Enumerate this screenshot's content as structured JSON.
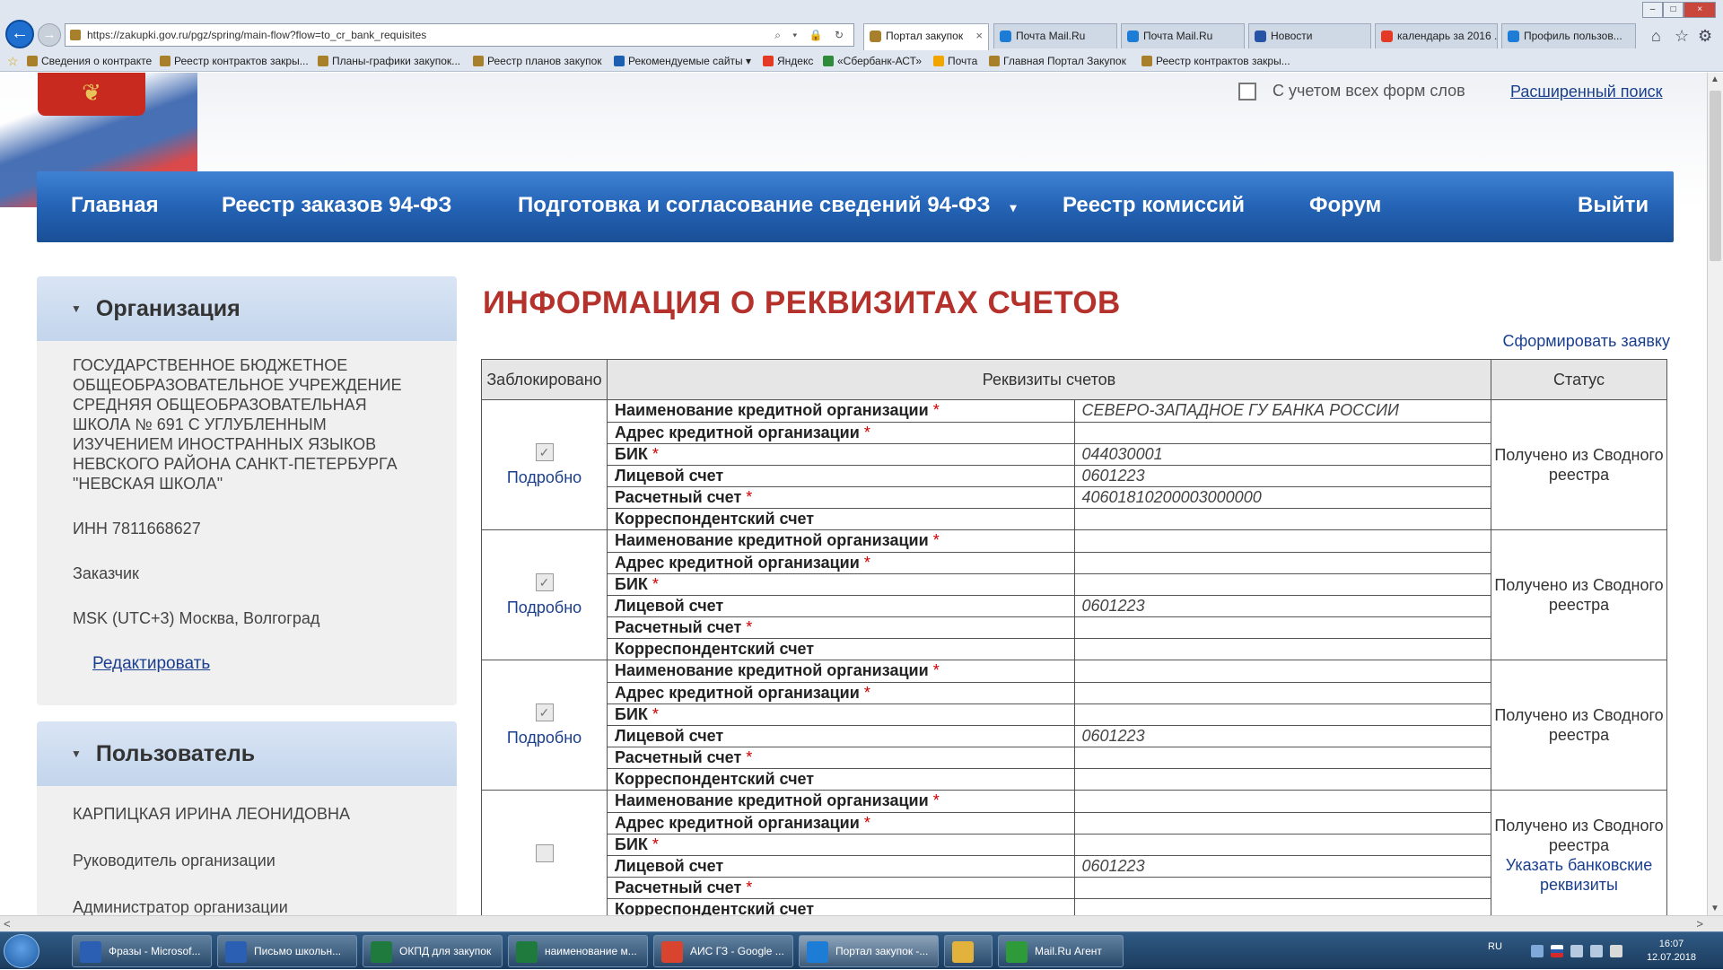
{
  "browser": {
    "url": "https://zakupki.gov.ru/pgz/spring/main-flow?flow=to_cr_bank_requisites",
    "addr_controls": "⌕ ▾ 🔒 ↻",
    "tabs": [
      {
        "label": "Портал закупок",
        "active": true,
        "close": "×",
        "color": "#a87f2b"
      },
      {
        "label": "Почта Mail.Ru",
        "color": "#1c7cd6"
      },
      {
        "label": "Почта Mail.Ru",
        "color": "#1c7cd6"
      },
      {
        "label": "Новости",
        "color": "#2553a6"
      },
      {
        "label": "календарь за 2016 ...",
        "color": "#e43a25"
      },
      {
        "label": "Профиль пользов...",
        "color": "#1c7cd6"
      }
    ],
    "home_icon": "⌂",
    "star_icon": "☆",
    "gear_icon": "⚙",
    "window_controls": [
      "–",
      "□",
      "×"
    ],
    "favorites": [
      {
        "label": "Сведения о контракте",
        "color": "#a87f2b"
      },
      {
        "label": "Реестр контрактов закры...",
        "color": "#a87f2b"
      },
      {
        "label": "Планы-графики закупок...",
        "color": "#a87f2b"
      },
      {
        "label": "Реестр планов закупок",
        "color": "#a87f2b"
      },
      {
        "label": "Рекомендуемые сайты ▾",
        "color": "#1c5fb0"
      },
      {
        "label": "Яндекс",
        "color": "#e43a25"
      },
      {
        "label": "«Сбербанк-АСТ»",
        "color": "#2e8b3a"
      },
      {
        "label": "Почта",
        "color": "#f0a500"
      },
      {
        "label": "Главная Портал Закупок",
        "color": "#a87f2b"
      },
      {
        "label": "Реестр контрактов закры...",
        "color": "#a87f2b"
      }
    ]
  },
  "header": {
    "emblem_icon": "❦",
    "all_word_forms": "С учетом всех форм слов",
    "advanced_search": "Расширенный поиск"
  },
  "menu": [
    {
      "label": "Главная"
    },
    {
      "label": "Реестр заказов 94-ФЗ"
    },
    {
      "label": "Подготовка и согласование сведений 94-ФЗ",
      "caret": "▾"
    },
    {
      "label": "Реестр комиссий"
    },
    {
      "label": "Форум"
    },
    {
      "label": "Выйти"
    }
  ],
  "sidebar": {
    "org_panel": {
      "title": "Организация",
      "toggle": "▼",
      "name": "ГОСУДАРСТВЕННОЕ БЮДЖЕТНОЕ ОБЩЕОБРАЗОВАТЕЛЬНОЕ УЧРЕЖДЕНИЕ СРЕДНЯЯ ОБЩЕОБРАЗОВАТЕЛЬНАЯ ШКОЛА № 691 С УГЛУБЛЕННЫМ ИЗУЧЕНИЕМ ИНОСТРАННЫХ ЯЗЫКОВ НЕВСКОГО РАЙОНА САНКТ-ПЕТЕРБУРГА \"НЕВСКАЯ ШКОЛА\"",
      "inn": "ИНН 7811668627",
      "role": "Заказчик",
      "timezone": "MSK (UTC+3) Москва, Волгоград",
      "edit": "Редактировать"
    },
    "user_panel": {
      "title": "Пользователь",
      "toggle": "▼",
      "name": "КАРПИЦКАЯ ИРИНА ЛЕОНИДОВНА",
      "role1": "Руководитель организации",
      "role2": "Администратор организации"
    }
  },
  "main": {
    "title": "ИНФОРМАЦИЯ О РЕКВИЗИТАХ СЧЕТОВ",
    "generate_request": "Сформировать заявку",
    "columns": {
      "blocked": "Заблокировано",
      "requisites": "Реквизиты счетов",
      "status": "Статус"
    },
    "details_link": "Подробно",
    "check_mark": "✓",
    "required_mark": "*",
    "accounts": [
      {
        "blocked": true,
        "show_details": true,
        "status": "Получено из Сводного реестра",
        "status_link": "",
        "rows": [
          {
            "label": "Наименование кредитной организации",
            "required": true,
            "value": "СЕВЕРО-ЗАПАДНОЕ ГУ БАНКА РОССИИ"
          },
          {
            "label": "Адрес кредитной организации",
            "required": true,
            "value": ""
          },
          {
            "label": "БИК",
            "required": true,
            "value": "044030001"
          },
          {
            "label": "Лицевой счет",
            "required": false,
            "value": "0601223"
          },
          {
            "label": "Расчетный счет",
            "required": true,
            "value": "40601810200003000000"
          },
          {
            "label": "Корреспондентский счет",
            "required": false,
            "value": ""
          }
        ]
      },
      {
        "blocked": true,
        "show_details": true,
        "status": "Получено из Сводного реестра",
        "status_link": "",
        "rows": [
          {
            "label": "Наименование кредитной организации",
            "required": true,
            "value": ""
          },
          {
            "label": "Адрес кредитной организации",
            "required": true,
            "value": ""
          },
          {
            "label": "БИК",
            "required": true,
            "value": ""
          },
          {
            "label": "Лицевой счет",
            "required": false,
            "value": "0601223"
          },
          {
            "label": "Расчетный счет",
            "required": true,
            "value": ""
          },
          {
            "label": "Корреспондентский счет",
            "required": false,
            "value": ""
          }
        ]
      },
      {
        "blocked": true,
        "show_details": true,
        "status": "Получено из Сводного реестра",
        "status_link": "",
        "rows": [
          {
            "label": "Наименование кредитной организации",
            "required": true,
            "value": ""
          },
          {
            "label": "Адрес кредитной организации",
            "required": true,
            "value": ""
          },
          {
            "label": "БИК",
            "required": true,
            "value": ""
          },
          {
            "label": "Лицевой счет",
            "required": false,
            "value": "0601223"
          },
          {
            "label": "Расчетный счет",
            "required": true,
            "value": ""
          },
          {
            "label": "Корреспондентский счет",
            "required": false,
            "value": ""
          }
        ]
      },
      {
        "blocked": false,
        "show_details": false,
        "status": "Получено из Сводного реестра",
        "status_link": "Указать банковские реквизиты",
        "rows": [
          {
            "label": "Наименование кредитной организации",
            "required": true,
            "value": ""
          },
          {
            "label": "Адрес кредитной организации",
            "required": true,
            "value": ""
          },
          {
            "label": "БИК",
            "required": true,
            "value": ""
          },
          {
            "label": "Лицевой счет",
            "required": false,
            "value": "0601223"
          },
          {
            "label": "Расчетный счет",
            "required": true,
            "value": ""
          },
          {
            "label": "Корреспондентский счет",
            "required": false,
            "value": ""
          }
        ]
      }
    ]
  },
  "scrollbars": {
    "left_arrow": "<",
    "right_arrow": ">",
    "up_arrow": "▲",
    "down_arrow": "▼"
  },
  "taskbar": {
    "items": [
      {
        "label": "Фразы - Microsof...",
        "color": "#2b5fb4"
      },
      {
        "label": "Письмо школьн...",
        "color": "#2b5fb4"
      },
      {
        "label": "ОКПД для закупок",
        "color": "#1f7a3e"
      },
      {
        "label": "наименование м...",
        "color": "#1f7a3e"
      },
      {
        "label": "АИС ГЗ - Google ...",
        "color": "#d9442f"
      },
      {
        "label": "Портал закупок -...",
        "color": "#1c7cd6",
        "active": true
      },
      {
        "label": "",
        "color": "#e3b23c"
      },
      {
        "label": "Mail.Ru Агент",
        "color": "#2e9b3a"
      }
    ],
    "lang": "RU",
    "time": "16:07",
    "date": "12.07.2018"
  }
}
